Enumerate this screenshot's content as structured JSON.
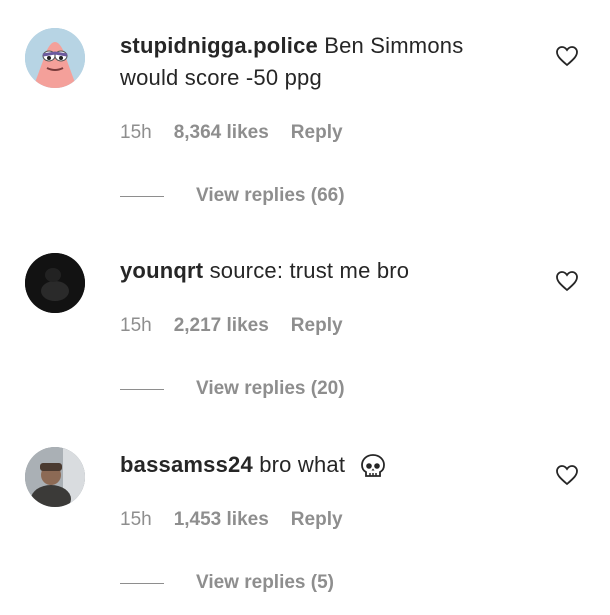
{
  "comments": [
    {
      "username": "stupidnigga.police",
      "text": "Ben Simmons would score -50 ppg",
      "time": "15h",
      "likes": "8,364 likes",
      "reply_label": "Reply",
      "view_replies": "View replies (66)",
      "avatar_icon": "patrick-star-avatar"
    },
    {
      "username": "younqrt",
      "text": "source: trust me bro",
      "time": "15h",
      "likes": "2,217 likes",
      "reply_label": "Reply",
      "view_replies": "View replies (20)",
      "avatar_icon": "dark-photo-avatar"
    },
    {
      "username": "bassamss24",
      "text": "bro what",
      "emoji_icon": "skull-emoji",
      "time": "15h",
      "likes": "1,453 likes",
      "reply_label": "Reply",
      "view_replies": "View replies (5)",
      "avatar_icon": "person-photo-avatar"
    }
  ],
  "colors": {
    "text": "#262626",
    "muted": "#8e8e8e",
    "background": "#ffffff"
  }
}
